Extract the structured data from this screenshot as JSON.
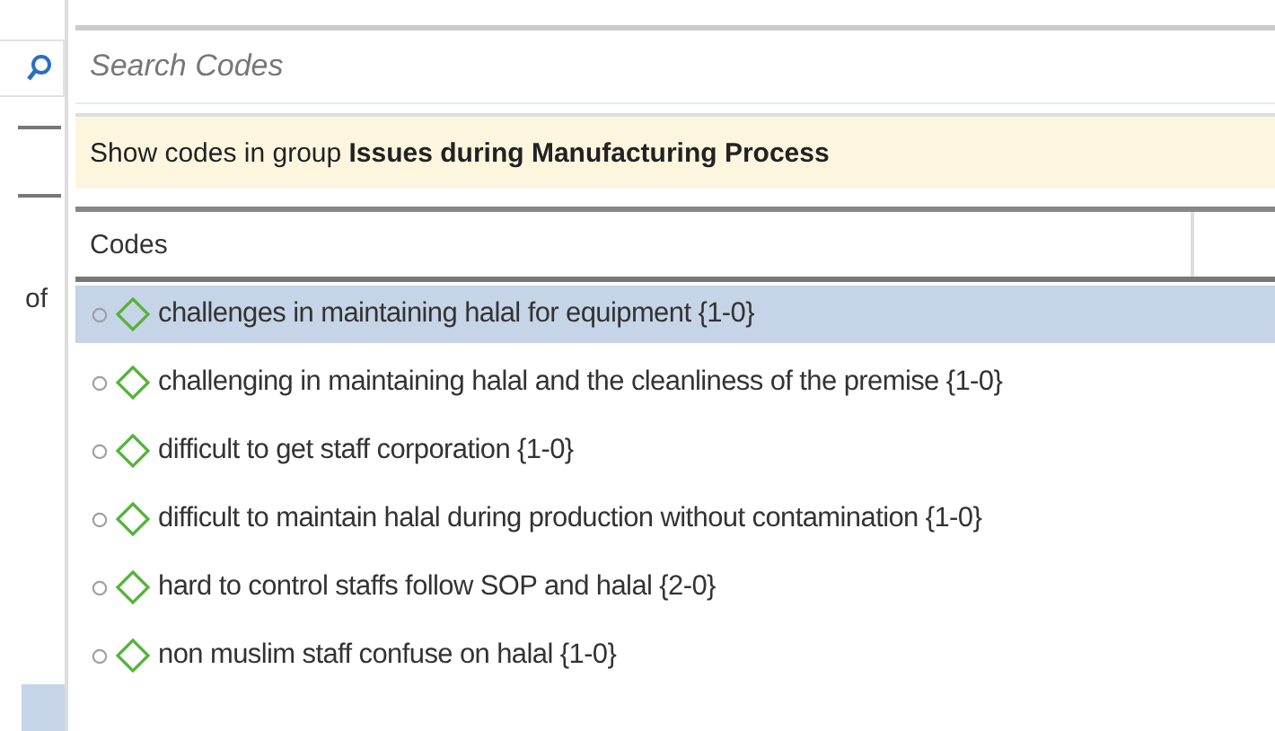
{
  "side_panel": {
    "text": "of"
  },
  "search": {
    "placeholder": "Search Codes"
  },
  "group_banner": {
    "text": "Show codes in group **Issues during Manufacturing Process**"
  },
  "table": {
    "columns": [
      "Codes"
    ],
    "rows": [
      {
        "label": "challenges in maintaining halal for equipment {1-0}",
        "selected": true
      },
      {
        "label": "challenging in maintaining halal and the cleanliness of the premise {1-0}",
        "selected": false
      },
      {
        "label": "difficult to get staff corporation {1-0}",
        "selected": false
      },
      {
        "label": "difficult to maintain halal during production without contamination {1-0}",
        "selected": false
      },
      {
        "label": "hard to control staffs follow SOP and halal {2-0}",
        "selected": false
      },
      {
        "label": "non muslim staff confuse on halal {1-0}",
        "selected": false
      }
    ]
  }
}
